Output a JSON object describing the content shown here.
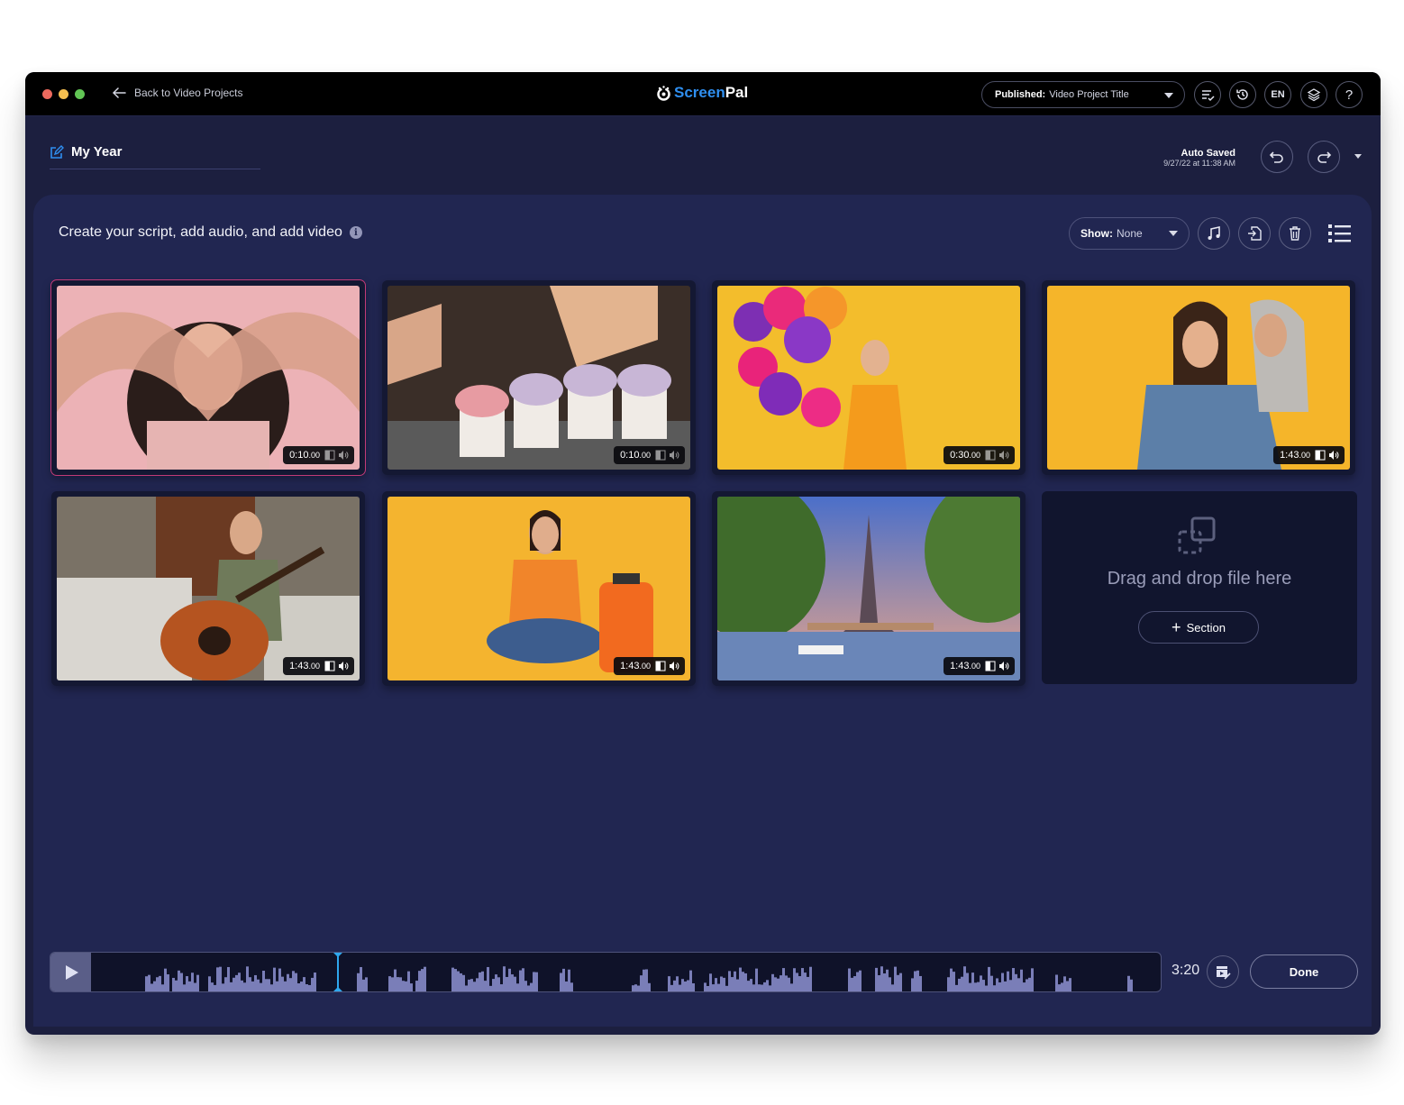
{
  "window": {
    "back_label": "Back to Video Projects",
    "logo": {
      "part1": "Screen",
      "part2": "Pal"
    },
    "publish_select": {
      "label": "Published:",
      "value": "Video Project Title"
    },
    "toolbar_buttons": [
      {
        "name": "captions-check",
        "icon": "list-check-icon"
      },
      {
        "name": "history",
        "icon": "history-icon"
      },
      {
        "name": "language",
        "label": "EN"
      },
      {
        "name": "layers",
        "icon": "layers-icon"
      },
      {
        "name": "help",
        "label": "?"
      }
    ]
  },
  "header": {
    "project_title": "My Year",
    "autosave_label": "Auto Saved",
    "autosave_time": "9/27/22 at 11:38 AM"
  },
  "panel": {
    "heading": "Create your script, add audio, and add video",
    "info_glyph": "i",
    "show_select": {
      "label": "Show:",
      "value": "None"
    }
  },
  "clips": [
    {
      "title": "Woman making heart with hands",
      "duration": "0:10",
      "ms": ".00",
      "selected": true,
      "audio_active": false
    },
    {
      "title": "Decorating cupcakes",
      "duration": "0:10",
      "ms": ".00",
      "selected": false,
      "audio_active": false
    },
    {
      "title": "Woman with balloons",
      "duration": "0:30",
      "ms": ".00",
      "selected": false,
      "audio_active": false
    },
    {
      "title": "Mother and daughter hugging",
      "duration": "1:43",
      "ms": ".00",
      "selected": false,
      "audio_active": true
    },
    {
      "title": "Woman playing guitar",
      "duration": "1:43",
      "ms": ".00",
      "selected": false,
      "audio_active": true
    },
    {
      "title": "Woman with suitcase",
      "duration": "1:43",
      "ms": ".00",
      "selected": false,
      "audio_active": true
    },
    {
      "title": "Eiffel Tower by river",
      "duration": "1:43",
      "ms": ".00",
      "selected": false,
      "audio_active": true
    }
  ],
  "dropzone": {
    "text": "Drag and drop file here",
    "section_button": "Section",
    "plus_glyph": "+"
  },
  "timeline": {
    "total_time": "3:20",
    "playhead_fraction": 0.23,
    "done_label": "Done"
  },
  "colors": {
    "accent_blue": "#2f8ff0",
    "selected_border": "#c23a77",
    "playhead": "#2fa7ee",
    "panel_bg": "#212651"
  }
}
